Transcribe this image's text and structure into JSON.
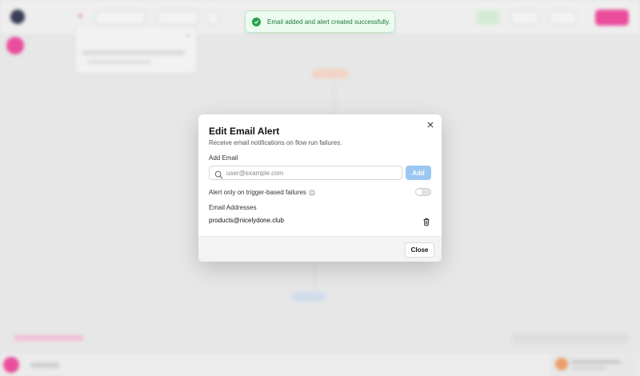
{
  "toast": {
    "message": "Email added and alert created successfully.",
    "status_color": "#24a148"
  },
  "modal": {
    "title": "Edit Email Alert",
    "subtitle": "Receive email notifications on flow run failures.",
    "add_email_label": "Add Email",
    "email_input": {
      "value": "",
      "placeholder": "user@example.com"
    },
    "add_button_label": "Add",
    "trigger_only_label": "Alert only on trigger-based failures",
    "trigger_only_enabled": false,
    "addresses_label": "Email Addresses",
    "addresses": [
      "products@nicelydone.club"
    ],
    "close_button_label": "Close"
  },
  "icons": {
    "toast": "check-circle-icon",
    "close": "close-icon",
    "search": "search-icon",
    "info": "info-icon",
    "delete": "trash-icon"
  },
  "colors": {
    "accent": "#ee4fa0",
    "add_button_disabled": "#9cc7f2",
    "success_bg": "#ecfbef",
    "success_text": "#1f7a3a"
  }
}
